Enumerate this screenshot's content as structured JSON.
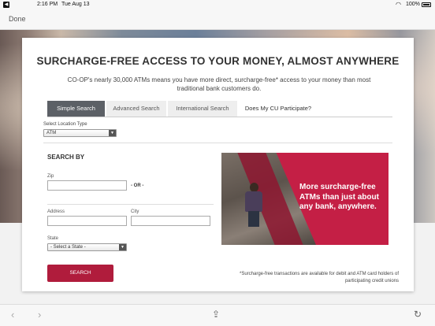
{
  "status_bar": {
    "time": "2:16 PM",
    "date": "Tue Aug 13",
    "battery": "100%"
  },
  "nav": {
    "done_label": "Done"
  },
  "page": {
    "headline": "SURCHARGE-FREE ACCESS TO YOUR MONEY, ALMOST ANYWHERE",
    "subtext": "CO-OP's nearly 30,000 ATMs means you have more direct, surcharge-free* access to your money than most traditional bank customers do.",
    "tabs": [
      {
        "label": "Simple Search",
        "active": true
      },
      {
        "label": "Advanced Search",
        "active": false
      },
      {
        "label": "International Search",
        "active": false
      },
      {
        "label": "Does My CU Participate?",
        "active": false
      }
    ],
    "location_type": {
      "label": "Select Location Type",
      "selected": "ATM"
    },
    "search_by": {
      "title": "SEARCH BY",
      "zip_label": "Zip",
      "or_text": "- OR -",
      "address_label": "Address",
      "city_label": "City",
      "state_label": "State",
      "state_selected": "- Select a State -",
      "search_button": "SEARCH"
    },
    "promo_text": "More surcharge-free ATMs than just about any bank, anywhere.",
    "disclaimer": "*Surcharge-free transactions are available for debit and ATM card holders of participating credit unions"
  },
  "colors": {
    "accent": "#b01c3c",
    "tab_active": "#5c6066"
  }
}
